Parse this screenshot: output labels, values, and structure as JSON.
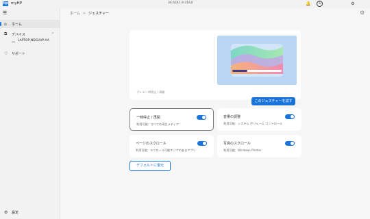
{
  "titlebar": {
    "app_logo_text": "hp",
    "app_title": "myHP",
    "version": "34.6241.9.31&0",
    "avatar_initial": "S",
    "icons": [
      "bell-icon",
      "user-icon",
      "gear-icon"
    ]
  },
  "sidebar": {
    "items": [
      {
        "label": "ホーム",
        "icon": "home-icon"
      },
      {
        "label": "デバイス",
        "icon": "devices-icon"
      },
      {
        "label": "サポート",
        "icon": "support-icon"
      }
    ],
    "device_name": "LAPTOP-NDGVVP-AA",
    "settings_label": "設定"
  },
  "breadcrumb": {
    "home": "ホーム",
    "current": "ジェスチャー"
  },
  "hero": {
    "hint": "プレイ/一時停止 / 再開",
    "try_button": "このジェスチャーを試す"
  },
  "tiles": [
    {
      "title": "一時停止 / 再開",
      "subtitle": "利用可能：すべての再生メディア",
      "enabled": true
    },
    {
      "title": "音量の調整",
      "subtitle": "利用可能：システム ボリューム コントロール",
      "enabled": true
    },
    {
      "title": "ページのスクロール",
      "subtitle": "利用可能：スクロール可能エリアのあるアプリ",
      "enabled": true
    },
    {
      "title": "写真のスクロール",
      "subtitle": "利用可能：Windows Photos",
      "enabled": true
    }
  ],
  "reset_button": "デフォルトに復元",
  "colors": {
    "accent": "#1a73d9"
  }
}
